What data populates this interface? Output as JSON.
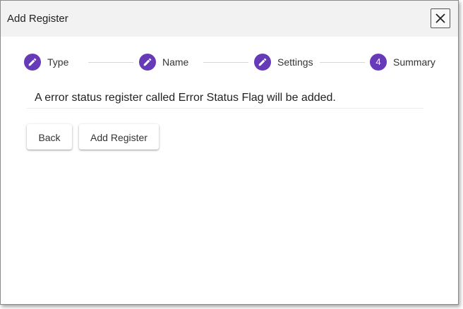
{
  "dialog": {
    "title": "Add Register",
    "close_icon": "close-icon"
  },
  "stepper": {
    "accent_color": "#673ab7",
    "steps": [
      {
        "label": "Type",
        "state": "edit",
        "icon": "pencil-icon"
      },
      {
        "label": "Name",
        "state": "edit",
        "icon": "pencil-icon"
      },
      {
        "label": "Settings",
        "state": "edit",
        "icon": "pencil-icon"
      },
      {
        "label": "Summary",
        "state": "current",
        "number": "4"
      }
    ]
  },
  "summary": {
    "message": "A error status register called Error Status Flag will be added."
  },
  "actions": {
    "back_label": "Back",
    "add_label": "Add Register"
  }
}
